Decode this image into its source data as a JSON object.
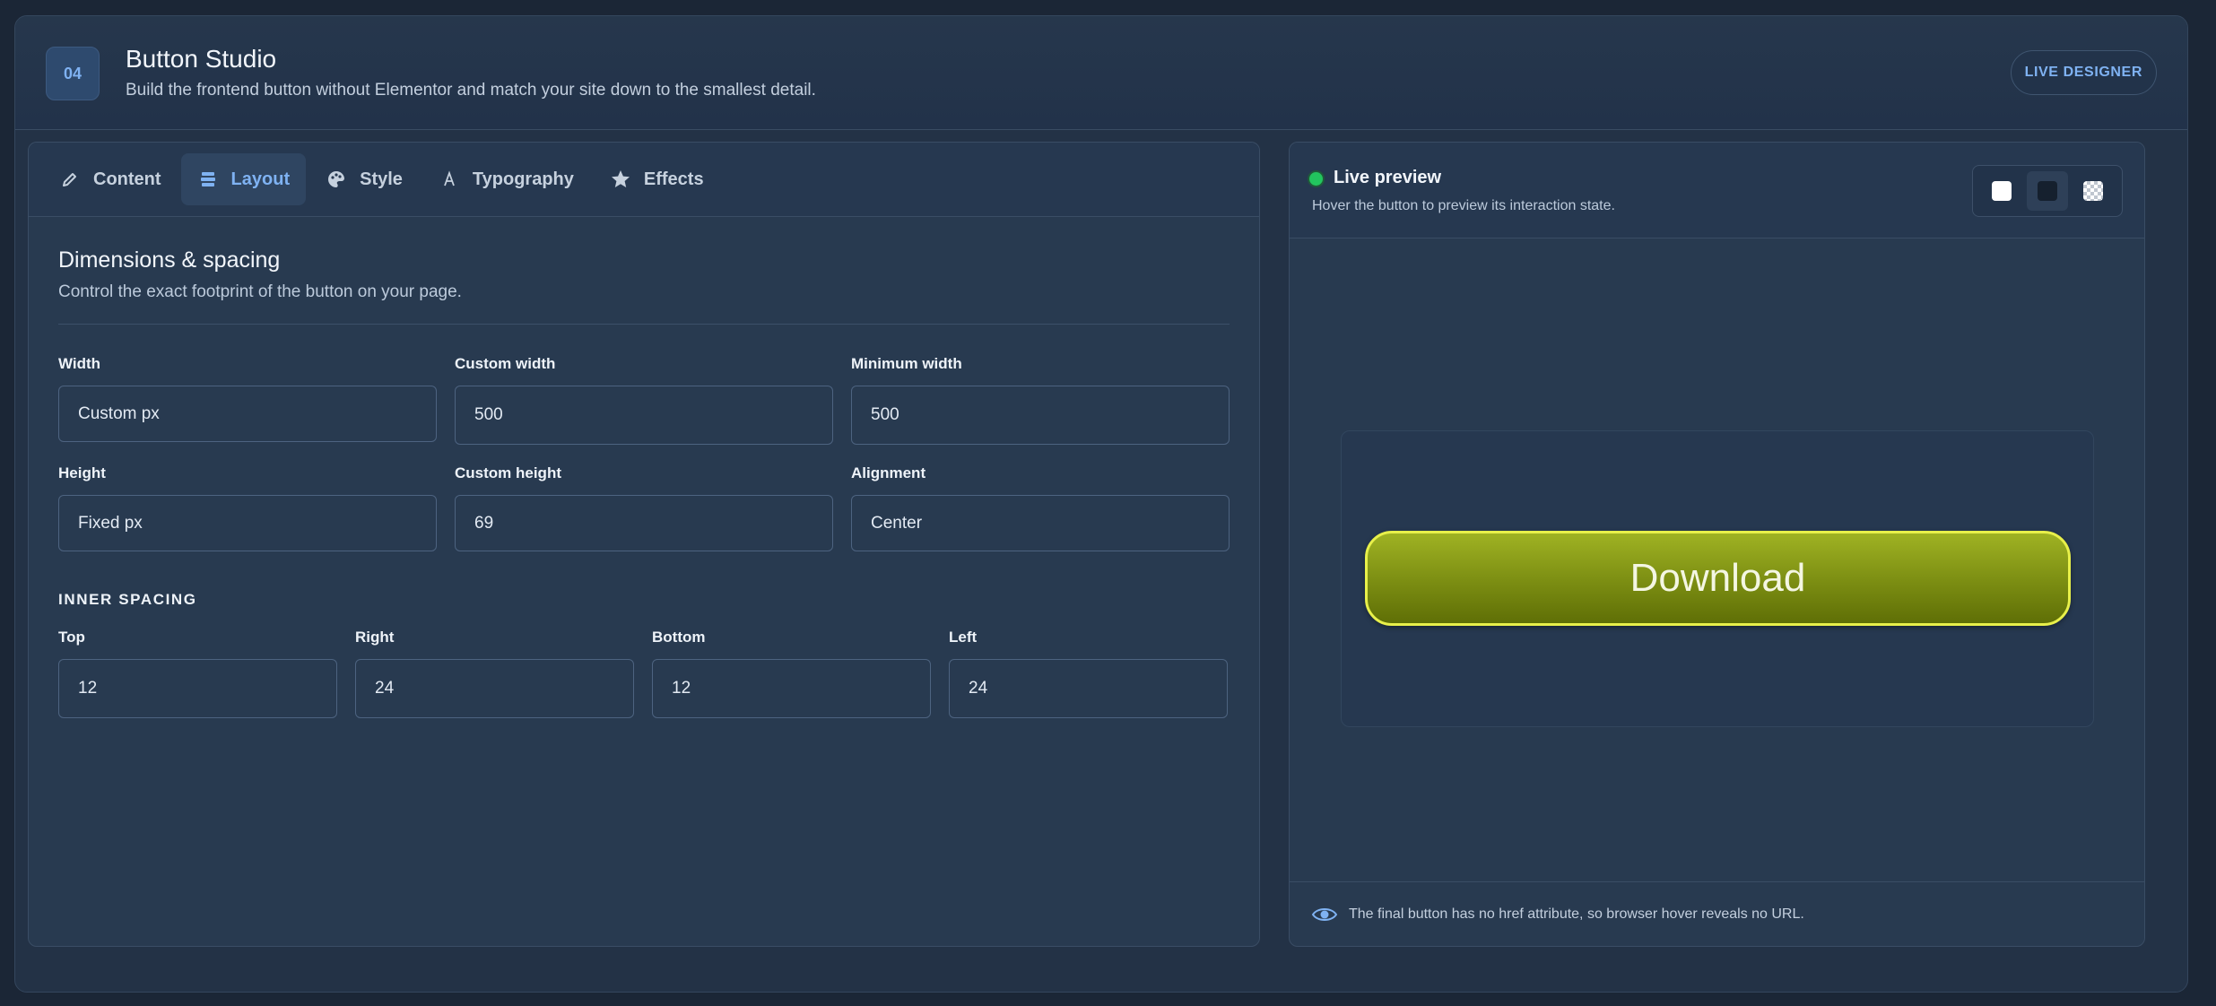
{
  "header": {
    "step": "04",
    "title": "Button Studio",
    "subtitle": "Build the frontend button without Elementor and match your site down to the smallest detail.",
    "badge": "LIVE DESIGNER"
  },
  "tabs": [
    {
      "label": "Content",
      "icon": "pencil-icon"
    },
    {
      "label": "Layout",
      "icon": "layout-icon",
      "active": true
    },
    {
      "label": "Style",
      "icon": "palette-icon"
    },
    {
      "label": "Typography",
      "icon": "typography-icon"
    },
    {
      "label": "Effects",
      "icon": "star-icon"
    }
  ],
  "layout": {
    "title": "Dimensions & spacing",
    "description": "Control the exact footprint of the button on your page.",
    "fields": {
      "width": {
        "label": "Width",
        "value": "Custom px"
      },
      "custom_width": {
        "label": "Custom width",
        "value": "500"
      },
      "min_width": {
        "label": "Minimum width",
        "value": "500"
      },
      "height": {
        "label": "Height",
        "value": "Fixed px"
      },
      "custom_height": {
        "label": "Custom height",
        "value": "69"
      },
      "alignment": {
        "label": "Alignment",
        "value": "Center"
      }
    },
    "inner_spacing": {
      "heading": "INNER SPACING",
      "top": {
        "label": "Top",
        "value": "12"
      },
      "right": {
        "label": "Right",
        "value": "24"
      },
      "bottom": {
        "label": "Bottom",
        "value": "12"
      },
      "left": {
        "label": "Left",
        "value": "24"
      }
    }
  },
  "preview": {
    "title": "Live preview",
    "hint": "Hover the button to preview its interaction state.",
    "backgrounds": [
      "white",
      "dark",
      "transparent"
    ],
    "selected_background": "dark",
    "button_label": "Download",
    "footer_note": "The final button has no href attribute, so browser hover reveals no URL.",
    "colors": {
      "button_border": "#e8f04a",
      "button_fill_top": "#9fb223",
      "button_fill_bottom": "#5f6f06",
      "status": "#22c55e",
      "accent": "#7fb2f2"
    }
  }
}
